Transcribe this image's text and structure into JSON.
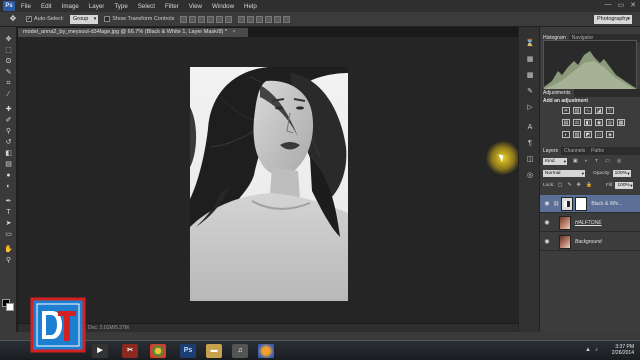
{
  "app": {
    "logo_text": "Ps",
    "menus": [
      "File",
      "Edit",
      "Image",
      "Layer",
      "Type",
      "Select",
      "Filter",
      "View",
      "Window",
      "Help"
    ],
    "window_controls": [
      "—",
      "▭",
      "✕"
    ]
  },
  "options_bar": {
    "tool_icon": "move-tool-icon",
    "auto_select_label": "Auto-Select:",
    "auto_select_checked": true,
    "auto_select_target": "Group",
    "transform_controls_label": "Show Transform Controls",
    "workspace": "Photography"
  },
  "document": {
    "tab_title": "model_anna2_by_meysoul-d34lage.jpg @ 66.7% (Black & White 1, Layer Mask/8) *",
    "tab_close": "×",
    "status_text": "Doc: 2.01M/5.37M"
  },
  "panels": {
    "top_tabs": [
      {
        "label": "Histogram",
        "active": true
      },
      {
        "label": "Navigator",
        "active": false
      }
    ],
    "adjustments": {
      "tab_label": "Adjustments",
      "title": "Add an adjustment"
    },
    "layers": {
      "tabs": [
        {
          "label": "Layers",
          "active": true
        },
        {
          "label": "Channels",
          "active": false
        },
        {
          "label": "Paths",
          "active": false
        }
      ],
      "filter_kind": "Kind",
      "blend_mode": "Normal",
      "opacity_label": "Opacity:",
      "opacity_value": "100%",
      "lock_label": "Lock:",
      "fill_label": "Fill:",
      "fill_value": "100%",
      "items": [
        {
          "name": "Black & Whi...",
          "visible": true,
          "selected": true,
          "type": "adjustment"
        },
        {
          "name": "HALFTONE",
          "visible": true,
          "selected": false,
          "type": "image"
        },
        {
          "name": "Background",
          "visible": true,
          "selected": false,
          "type": "image"
        }
      ]
    }
  },
  "taskbar": {
    "apps": [
      "windows-start-icon",
      "media-player-icon",
      "tools-icon",
      "chrome-icon",
      "photoshop-icon",
      "folder-icon",
      "media-icon",
      "firefox-icon"
    ],
    "ps_label": "Ps",
    "time": "3:37 PM",
    "date": "2/26/2014"
  },
  "colors": {
    "selected_layer": "#5b6f97",
    "cursor_highlight": "#f2d21a",
    "logo_red": "#d32020",
    "logo_blue": "#1e7fd0"
  }
}
